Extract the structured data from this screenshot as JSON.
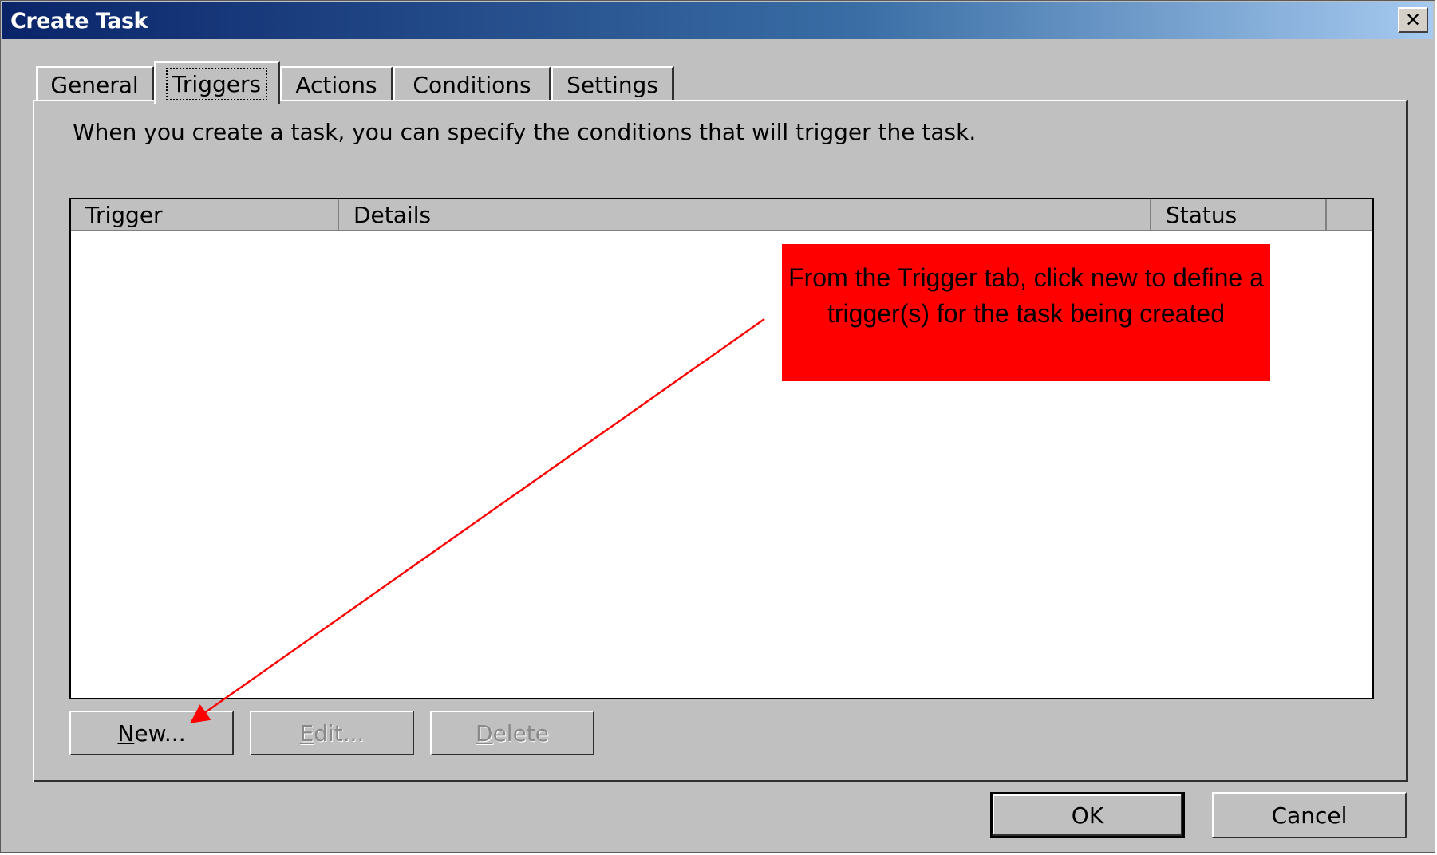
{
  "window": {
    "title": "Create Task",
    "close_glyph": "✕",
    "close_icon": "close-icon"
  },
  "tabs": [
    {
      "label": "General",
      "active": false
    },
    {
      "label": "Triggers",
      "active": true
    },
    {
      "label": "Actions",
      "active": false
    },
    {
      "label": "Conditions",
      "active": false
    },
    {
      "label": "Settings",
      "active": false
    }
  ],
  "triggers": {
    "description": "When you create a task, you can specify the conditions that will trigger the task.",
    "columns": [
      "Trigger",
      "Details",
      "Status"
    ],
    "rows": [],
    "buttons": {
      "new": {
        "mnemonic": "N",
        "rest": "ew...",
        "enabled": true
      },
      "edit": {
        "mnemonic": "E",
        "rest": "dit...",
        "enabled": false
      },
      "delete": {
        "mnemonic": "D",
        "rest": "elete",
        "enabled": false
      }
    }
  },
  "footer": {
    "ok_label": "OK",
    "cancel_label": "Cancel"
  },
  "annotation": {
    "text": "From the Trigger tab, click new to define a trigger(s) for the task being created",
    "color": "#ff0000"
  }
}
